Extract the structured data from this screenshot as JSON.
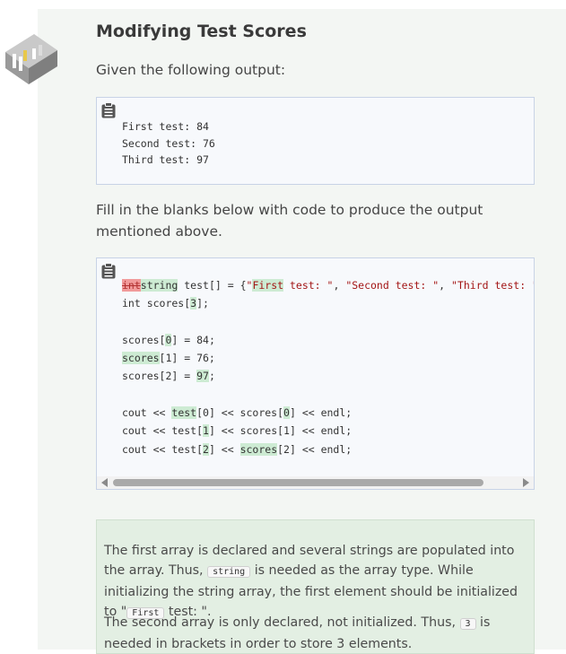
{
  "page": {
    "title": "Modifying Test Scores",
    "intro": "Given the following output:",
    "fill_instructions": "Fill in the blanks below with code to produce the output mentioned above."
  },
  "output_block": {
    "lines": [
      "First test: 84",
      "Second test: 76",
      "Third test: 97"
    ]
  },
  "code_block": {
    "deleted_answer": "int",
    "answers": {
      "type": "string",
      "first_word": "First",
      "size": "3",
      "index0": "0",
      "scores_name": "scores",
      "value": "97",
      "test_name": "test",
      "idx0": "0",
      "idx1": "1",
      "idx2": "2",
      "scores_name2": "scores"
    }
  },
  "explanation": {
    "p1_a": "The first array is declared and several strings are populated into the array. Thus, ",
    "p1_code": "string",
    "p1_b": " is needed as the array type. While initializing the string array, the first element should be initialized to \"",
    "p1_code2": "First",
    "p1_c": " test: \".",
    "p2_a": "The second array is only declared, not initialized. Thus, ",
    "p2_code": "3",
    "p2_b": " is needed in brackets in order to store 3 elements."
  },
  "colors": {
    "panel_bg": "#f3f6f3",
    "explain_bg": "#e3efe3",
    "inserted_highlight": "#cdebd3",
    "deleted_highlight": "#f19b9b"
  }
}
